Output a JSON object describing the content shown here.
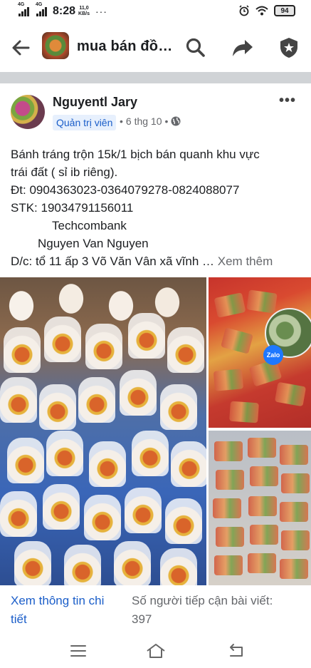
{
  "status_bar": {
    "network1": "4G",
    "network2": "4G",
    "time": "8:28",
    "speed_value": "11,0",
    "speed_unit": "KB/s",
    "dots": "···",
    "battery": "94"
  },
  "header": {
    "title": "mua bán đồ…"
  },
  "post": {
    "author": "Nguyentl Jary",
    "role_badge": "Quản trị viên",
    "date": "6 thg 10",
    "separator": "•",
    "more": "•••",
    "lines": [
      "Bánh tráng trộn 15k/1 bịch bán quanh khu vực",
      "trái đất ( sỉ ib riêng).",
      "Đt: 0904363023-0364079278-0824088077",
      "STK: 19034791156011",
      "Techcombank",
      "Nguyen Van Nguyen",
      "D/c: tổ 11 ấp 3 Võ Văn Vân xã vĩnh …"
    ],
    "see_more": "Xem thêm",
    "zalo_label": "Zalo"
  },
  "footer": {
    "view_details": "Xem thông tin chi tiết",
    "reach_label": "Số người tiếp cận bài viết:",
    "reach_value": "397"
  },
  "icons": {
    "back": "arrow-left-icon",
    "search": "search-icon",
    "share": "share-icon",
    "shield": "shield-star-icon",
    "globe": "globe-icon",
    "menu": "menu-icon",
    "home": "home-icon",
    "return": "back-nav-icon"
  }
}
